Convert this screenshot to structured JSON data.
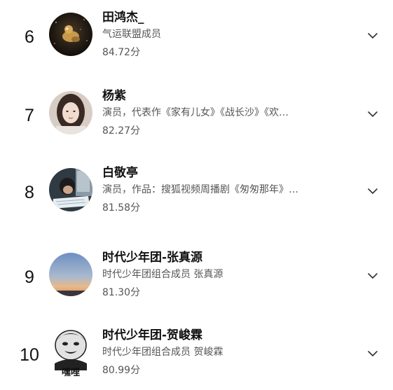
{
  "rankings": [
    {
      "rank": "6",
      "name": "田鸿杰_",
      "description": "气运联盟成员",
      "score": "84.72分",
      "avatar_icon": "night-figure-avatar"
    },
    {
      "rank": "7",
      "name": "杨紫",
      "description": "演员，代表作《家有儿女》《战长沙》《欢…",
      "score": "82.27分",
      "avatar_icon": "portrait-avatar"
    },
    {
      "rank": "8",
      "name": "白敬亭",
      "description": "演员，作品：搜狐视频周播剧《匆匆那年》…",
      "score": "81.58分",
      "avatar_icon": "reading-portrait-avatar"
    },
    {
      "rank": "9",
      "name": "时代少年团-张真源",
      "description": "时代少年团组合成员 张真源",
      "score": "81.30分",
      "avatar_icon": "sunset-sky-avatar"
    },
    {
      "rank": "10",
      "name": "时代少年团-贺峻霖",
      "description": "时代少年团组合成员 贺峻霖",
      "score": "80.99分",
      "avatar_icon": "meme-face-avatar",
      "avatar_caption": "嘿哩"
    }
  ],
  "colors": {
    "text_primary": "#111111",
    "text_secondary": "#555555",
    "chevron": "#333333",
    "background": "#ffffff"
  },
  "icons": {
    "expand": "chevron-down-icon"
  }
}
